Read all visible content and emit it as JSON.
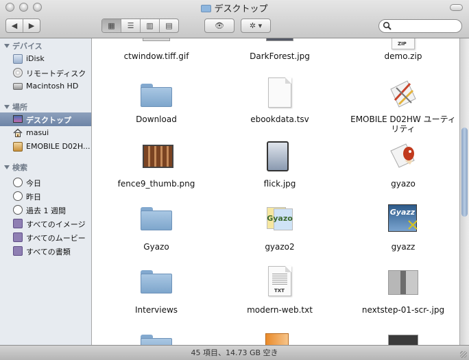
{
  "window": {
    "title": "デスクトップ"
  },
  "toolbar": {
    "back_label": "◀",
    "forward_label": "▶",
    "view_icons": "▦",
    "view_list": "☰",
    "view_columns": "▥",
    "view_coverflow": "▤",
    "quicklook_label": "👁",
    "action_label": "✲ ▾",
    "search_placeholder": ""
  },
  "sidebar": {
    "devices_header": "デバイス",
    "devices": [
      {
        "label": "iDisk",
        "icon": "idisk-icon"
      },
      {
        "label": "リモートディスク",
        "icon": "remote-disc-icon"
      },
      {
        "label": "Macintosh HD",
        "icon": "hard-drive-icon"
      }
    ],
    "places_header": "場所",
    "places": [
      {
        "label": "デスクトップ",
        "icon": "desktop-icon",
        "selected": true
      },
      {
        "label": "masui",
        "icon": "home-icon"
      },
      {
        "label": "EMOBILE D02H...",
        "icon": "emobile-drive-icon"
      }
    ],
    "search_header": "検索",
    "searches": [
      {
        "label": "今日",
        "icon": "clock-icon"
      },
      {
        "label": "昨日",
        "icon": "clock-icon"
      },
      {
        "label": "過去 1 週間",
        "icon": "clock-icon"
      },
      {
        "label": "すべてのイメージ",
        "icon": "smart-folder-icon"
      },
      {
        "label": "すべてのムービー",
        "icon": "smart-folder-icon"
      },
      {
        "label": "すべての書類",
        "icon": "smart-folder-icon"
      }
    ]
  },
  "files": [
    {
      "label": "ctwindow.tiff.gif",
      "kind": "partial"
    },
    {
      "label": "DarkForest.jpg",
      "kind": "partial"
    },
    {
      "label": "demo.zip",
      "kind": "partial"
    },
    {
      "label": "Download",
      "kind": "folder"
    },
    {
      "label": "ebookdata.tsv",
      "kind": "document"
    },
    {
      "label": "EMOBILE D02HW ユーティリティ",
      "label_line1": "EMOBILE D02HW ユーティ",
      "label_line2": "リティ",
      "kind": "app"
    },
    {
      "label": "fence9_thumb.png",
      "kind": "image"
    },
    {
      "label": "flick.jpg",
      "kind": "image"
    },
    {
      "label": "gyazo",
      "kind": "app"
    },
    {
      "label": "Gyazo",
      "kind": "folder"
    },
    {
      "label": "gyazo2",
      "kind": "app",
      "badge": "Gyazo"
    },
    {
      "label": "gyazz",
      "kind": "app",
      "badge": "Gyazz"
    },
    {
      "label": "Interviews",
      "kind": "folder"
    },
    {
      "label": "modern-web.txt",
      "kind": "text",
      "badge": "TXT"
    },
    {
      "label": "nextstep-01-scr-.jpg",
      "kind": "image"
    }
  ],
  "status": {
    "text": "45 項目、14.73 GB 空き"
  },
  "colors": {
    "selection": "#7a8fb0",
    "sidebar_bg": "#e7ebf0",
    "folder": "#8fb3d9"
  }
}
